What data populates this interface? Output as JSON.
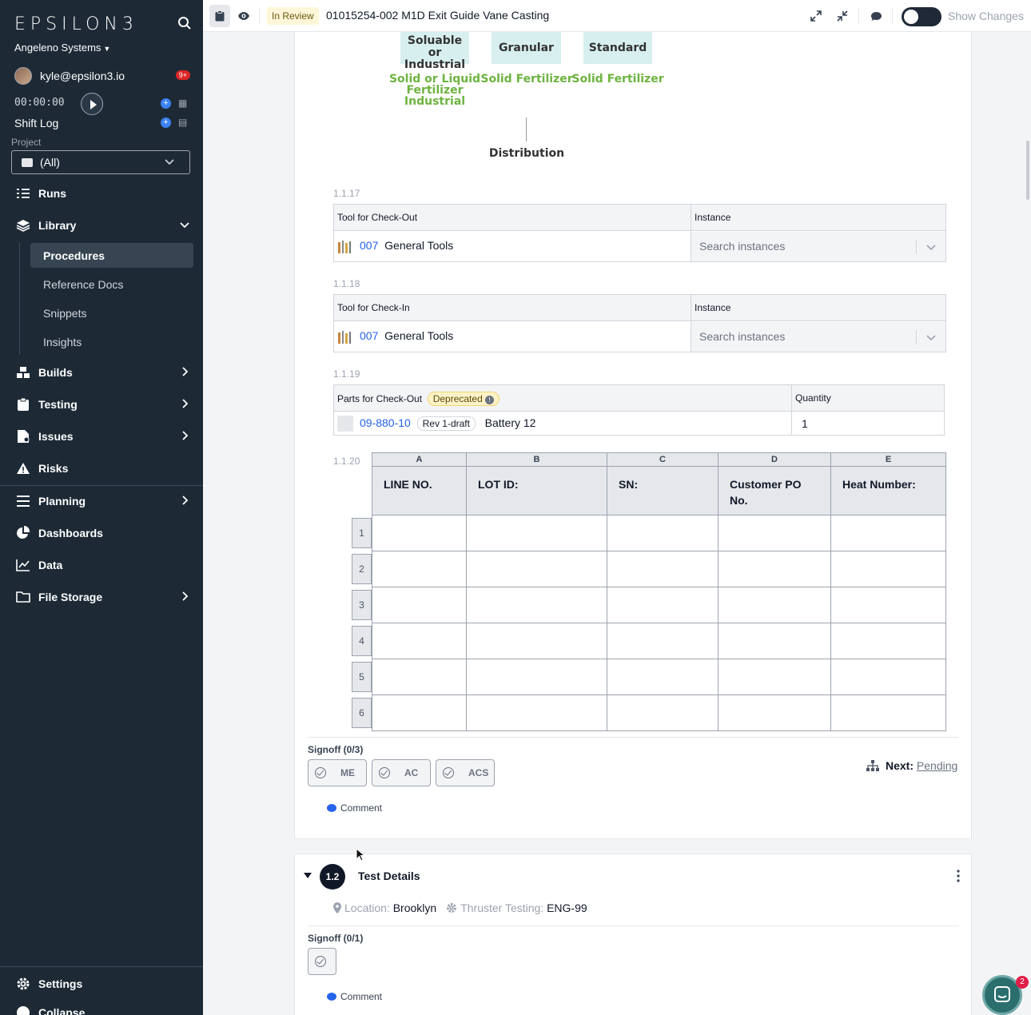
{
  "sidebar": {
    "logo": "EPSILON3",
    "org": "Angeleno Systems",
    "user_email": "kyle@epsilon3.io",
    "notif_count": "9+",
    "timer": "00:00:00",
    "shift_log": "Shift Log",
    "project_label": "Project",
    "project_value": "(All)",
    "nav": {
      "runs": "Runs",
      "library": "Library",
      "procedures": "Procedures",
      "reference_docs": "Reference Docs",
      "snippets": "Snippets",
      "insights": "Insights",
      "builds": "Builds",
      "testing": "Testing",
      "issues": "Issues",
      "risks": "Risks",
      "planning": "Planning",
      "dashboards": "Dashboards",
      "data": "Data",
      "file_storage": "File Storage",
      "settings": "Settings",
      "collapse": "Collapse"
    }
  },
  "topbar": {
    "status": "In Review",
    "title": "01015254-002 M1D Exit Guide Vane Casting",
    "show_changes": "Show Changes"
  },
  "diagram": {
    "box1": "Soluable or Industrial",
    "box2": "Granular",
    "box3": "Standard",
    "green1": "Solid or Liquid Fertilizer Industrial",
    "green2": "Solid Fertilizer",
    "green3": "Solid Fertilizer",
    "distribution": "Distribution"
  },
  "steps": {
    "s117": {
      "num": "1.1.17",
      "col1": "Tool for Check-Out",
      "col2": "Instance",
      "tool_id": "007",
      "tool_name": "General Tools",
      "placeholder": "Search instances"
    },
    "s118": {
      "num": "1.1.18",
      "col1": "Tool for Check-In",
      "col2": "Instance",
      "tool_id": "007",
      "tool_name": "General Tools",
      "placeholder": "Search instances"
    },
    "s119": {
      "num": "1.1.19",
      "col1": "Parts for Check-Out",
      "deprecated": "Deprecated",
      "col2": "Quantity",
      "part_id": "09-880-10",
      "rev": "Rev 1-draft",
      "part_name": "Battery 12",
      "quantity": "1"
    },
    "s120": {
      "num": "1.1.20",
      "columns": [
        "A",
        "B",
        "C",
        "D",
        "E"
      ],
      "headers": [
        "LINE NO.",
        "LOT ID:",
        "SN:",
        "Customer PO No.",
        "Heat Number:"
      ],
      "rows": [
        "1",
        "2",
        "3",
        "4",
        "5",
        "6"
      ]
    }
  },
  "signoff1": {
    "label": "Signoff (0/3)",
    "roles": [
      "ME",
      "AC",
      "ACS"
    ],
    "next_label": "Next:",
    "next_value": "Pending",
    "comment": "Comment"
  },
  "section2": {
    "number": "1.2",
    "title": "Test Details",
    "location_label": "Location:",
    "location_value": "Brooklyn",
    "thruster_label": "Thruster Testing:",
    "thruster_value": "ENG-99",
    "signoff_label": "Signoff (0/1)",
    "comment": "Comment"
  },
  "chat": {
    "count": "2"
  }
}
